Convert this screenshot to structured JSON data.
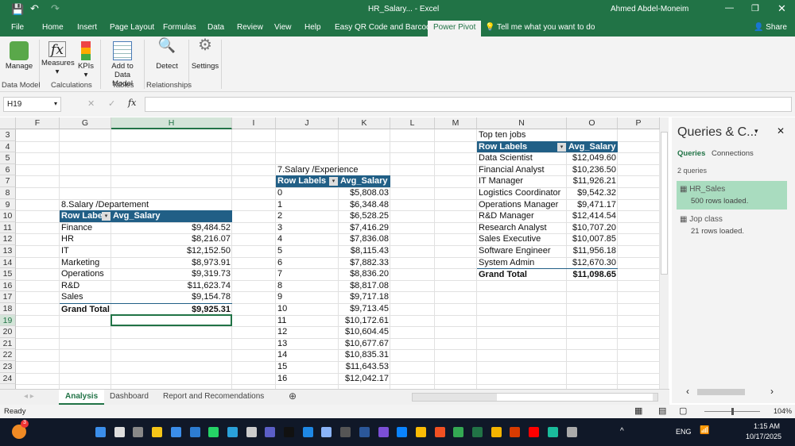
{
  "title": {
    "doc": "HR_Salary... - Excel",
    "user": "Ahmed Abdel-Moneim"
  },
  "tabs": [
    "File",
    "Home",
    "Insert",
    "Page Layout",
    "Formulas",
    "Data",
    "Review",
    "View",
    "Help",
    "Easy QR Code and Barcode",
    "Power Pivot"
  ],
  "tell_me": "Tell me what you want to do",
  "share": "Share",
  "ribbon": {
    "manage": "Manage",
    "measures": "Measures",
    "kpis": "KPIs",
    "add1": "Add to",
    "add2": "Data Model",
    "detect": "Detect",
    "settings": "Settings",
    "groups": [
      "Data Model",
      "Calculations",
      "Tables",
      "Relationships"
    ]
  },
  "name_box": "H19",
  "columns": [
    "F",
    "G",
    "H",
    "I",
    "J",
    "K",
    "L",
    "M",
    "N",
    "O",
    "P"
  ],
  "rows": [
    3,
    4,
    5,
    6,
    7,
    8,
    9,
    10,
    11,
    12,
    13,
    14,
    15,
    16,
    17,
    18,
    19,
    20,
    21,
    22,
    23,
    24
  ],
  "pivot_dept": {
    "title": "8.Salary /Departement",
    "h1": "Row Labels",
    "h2": "Avg_Salary",
    "rows": [
      [
        "Finance",
        "$9,484.52"
      ],
      [
        "HR",
        "$8,216.07"
      ],
      [
        "IT",
        "$12,152.50"
      ],
      [
        "Marketing",
        "$8,973.91"
      ],
      [
        "Operations",
        "$9,319.73"
      ],
      [
        "R&D",
        "$11,623.74"
      ],
      [
        "Sales",
        "$9,154.78"
      ]
    ],
    "total": [
      "Grand Total",
      "$9,925.31"
    ]
  },
  "pivot_exp": {
    "title": "7.Salary /Experience",
    "h1": "Row Labels",
    "h2": "Avg_Salary",
    "rows": [
      [
        "0",
        "$5,808.03"
      ],
      [
        "1",
        "$6,348.48"
      ],
      [
        "2",
        "$6,528.25"
      ],
      [
        "3",
        "$7,416.29"
      ],
      [
        "4",
        "$7,836.08"
      ],
      [
        "5",
        "$8,115.43"
      ],
      [
        "6",
        "$7,882.33"
      ],
      [
        "7",
        "$8,836.20"
      ],
      [
        "8",
        "$8,817.08"
      ],
      [
        "9",
        "$9,717.18"
      ],
      [
        "10",
        "$9,713.45"
      ],
      [
        "11",
        "$10,172.61"
      ],
      [
        "12",
        "$10,604.45"
      ],
      [
        "13",
        "$10,677.67"
      ],
      [
        "14",
        "$10,835.31"
      ],
      [
        "15",
        "$11,643.53"
      ],
      [
        "16",
        "$12,042.17"
      ]
    ]
  },
  "pivot_jobs": {
    "title": "Top ten jobs",
    "h1": "Row Labels",
    "h2": "Avg_Salary",
    "rows": [
      [
        "Data Scientist",
        "$12,049.60"
      ],
      [
        "Financial Analyst",
        "$10,236.50"
      ],
      [
        "IT Manager",
        "$11,926.21"
      ],
      [
        "Logistics Coordinator",
        "$9,542.32"
      ],
      [
        "Operations Manager",
        "$9,471.17"
      ],
      [
        "R&D Manager",
        "$12,414.54"
      ],
      [
        "Research Analyst",
        "$10,707.20"
      ],
      [
        "Sales Executive",
        "$10,007.85"
      ],
      [
        "Software Engineer",
        "$11,956.18"
      ],
      [
        "System Admin",
        "$12,670.30"
      ]
    ],
    "total": [
      "Grand Total",
      "$11,098.65"
    ]
  },
  "queries": {
    "title": "Queries & C...",
    "tab1": "Queries",
    "tab2": "Connections",
    "count": "2 queries",
    "items": [
      {
        "name": "HR_Sales",
        "info": "500 rows loaded."
      },
      {
        "name": "Jop class",
        "info": "21 rows loaded."
      }
    ]
  },
  "sheets": [
    "Analysis",
    "Dashboard",
    "Report and Recomendations"
  ],
  "status": {
    "ready": "Ready",
    "zoom": "104%"
  },
  "taskbar": {
    "time": "1:15 AM",
    "date": "10/17/2025",
    "lang": "ENG",
    "badge": "3"
  },
  "colors": {
    "excel": "#217346",
    "pivot_header": "#215f86",
    "selected_query": "#a9dcbf"
  }
}
